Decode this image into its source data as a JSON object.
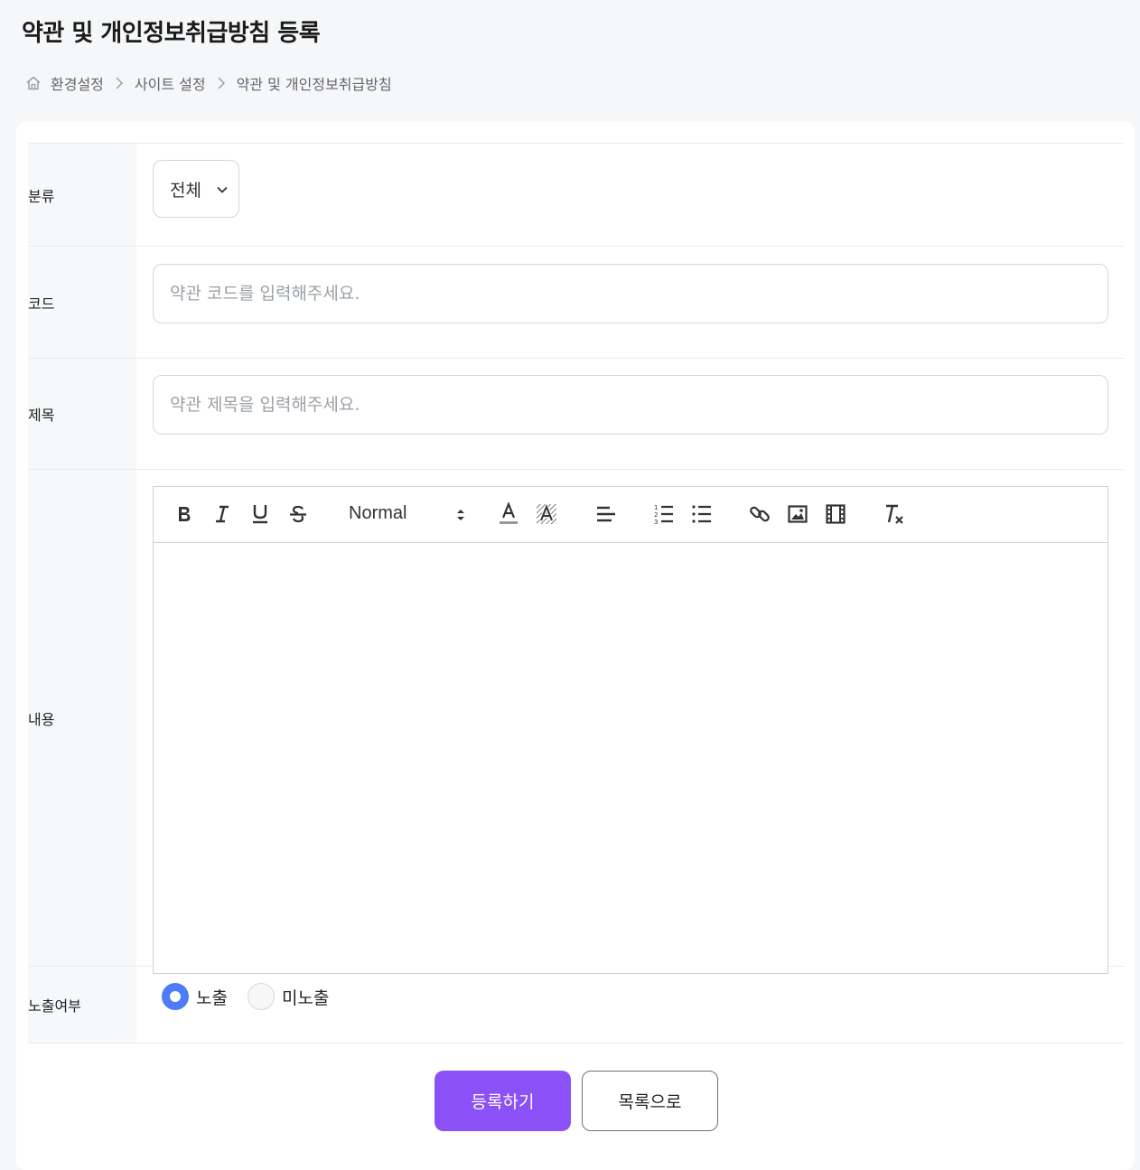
{
  "page": {
    "title": "약관 및 개인정보취급방침 등록"
  },
  "breadcrumb": {
    "items": [
      "환경설정",
      "사이트 설정",
      "약관 및 개인정보취급방침"
    ],
    "home_icon": "home-icon",
    "separator_icon": "chevron-right-icon"
  },
  "form": {
    "category": {
      "label": "분류",
      "selected": "전체"
    },
    "code": {
      "label": "코드",
      "value": "",
      "placeholder": "약관 코드를 입력해주세요."
    },
    "title": {
      "label": "제목",
      "value": "",
      "placeholder": "약관 제목을 입력해주세요."
    },
    "content": {
      "label": "내용",
      "format_select": "Normal",
      "toolbar": [
        "bold-icon",
        "italic-icon",
        "underline-icon",
        "strike-icon",
        "format-select",
        "text-color-icon",
        "background-color-icon",
        "align-left-icon",
        "ordered-list-icon",
        "bullet-list-icon",
        "link-icon",
        "image-icon",
        "video-icon",
        "clear-format-icon"
      ]
    },
    "visibility": {
      "label": "노출여부",
      "options": [
        "노출",
        "미노출"
      ],
      "selected": "노출"
    }
  },
  "actions": {
    "submit_label": "등록하기",
    "list_label": "목록으로"
  },
  "colors": {
    "primary": "#8b51f6",
    "radio_selected": "#4d7cf6",
    "label_bg": "#f7f8fa"
  }
}
